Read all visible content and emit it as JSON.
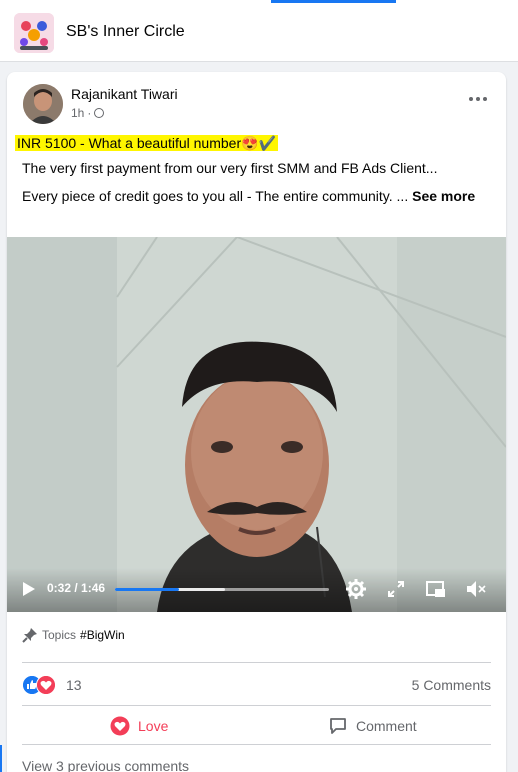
{
  "group": {
    "name": "SB's Inner Circle"
  },
  "post": {
    "author": "Rajanikant Tiwari",
    "time": "1h",
    "meta_separator": "·",
    "line1": "INR 5100 - What a beautiful number",
    "line1_emoji": "😍✔️",
    "line2": "The very first payment from our very first SMM and FB Ads Client...",
    "line3": "Every piece of credit goes to you all - The entire community. ...",
    "see_more": "See more"
  },
  "video": {
    "time_display": "0:32 / 1:46",
    "progress_fraction": 0.3
  },
  "topics": {
    "label": "Topics",
    "tag": "#BigWin"
  },
  "engagement": {
    "reaction_count": "13",
    "comments_label": "5 Comments"
  },
  "actions": {
    "love_label": "Love",
    "comment_label": "Comment"
  },
  "footer": {
    "view_previous": "View 3 previous comments"
  },
  "colors": {
    "accent": "#1877f2",
    "love": "#f33e58",
    "highlight": "#fff600"
  }
}
